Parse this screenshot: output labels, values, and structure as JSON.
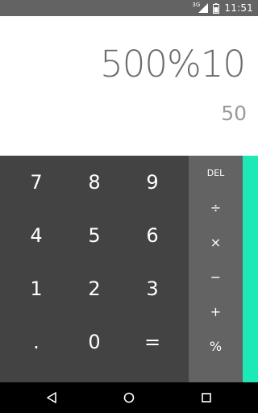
{
  "status_bar": {
    "network_label": "3G",
    "time": "11:51"
  },
  "display": {
    "formula": "500%10",
    "result": "50"
  },
  "keypad": {
    "digits": [
      "7",
      "8",
      "9",
      "4",
      "5",
      "6",
      "1",
      "2",
      "3",
      ".",
      "0",
      "="
    ]
  },
  "operators": {
    "del": "DEL",
    "divide": "÷",
    "multiply": "×",
    "minus": "−",
    "plus": "+",
    "percent": "%"
  },
  "colors": {
    "display_bg": "#ffffff",
    "pad_bg": "#434343",
    "ops_bg": "#636363",
    "accent": "#1de9b6",
    "status_bg": "#636363",
    "nav_bg": "#000000"
  },
  "nav_icons": [
    "back-icon",
    "home-icon",
    "recents-icon"
  ]
}
